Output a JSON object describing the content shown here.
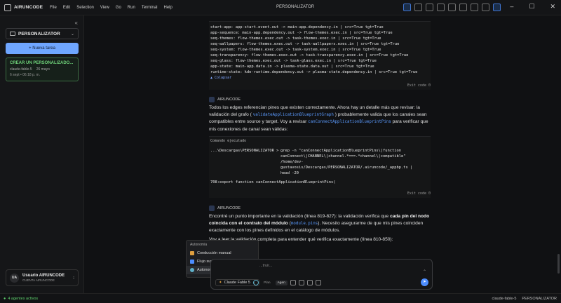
{
  "app": {
    "brand": "AIRUNCODE",
    "window_title": "PERSONALIZATOR",
    "menu": [
      "File",
      "Edit",
      "Selection",
      "View",
      "Go",
      "Run",
      "Terminal",
      "Help"
    ]
  },
  "sidebar": {
    "project": "PERSONALIZATOR",
    "new_task": "+ Nueva tarea",
    "task": {
      "title": "CREAR UN PERSONALIZADO...",
      "branch": "claude-fable-5",
      "age": "26 mayo",
      "date": "6 sept • 06:18 p. m."
    },
    "user": {
      "initials": "UA",
      "name": "Usuario AIRUNCODE",
      "sub": "CUENTA AIRUNCODE"
    }
  },
  "conversation": {
    "output_top": [
      "start-app: app-start.event.out -> main-app.dependency.in | src=True tgt=True",
      "app-sequence: main-app.dependency.out -> flow-themes.exec.in | src=True tgt=True",
      "seq-themes: flow-themes.exec.out -> task-themes.exec.in | src=True tgt=True",
      "seq-wallpapers: flow-themes.exec.out -> task-wallpapers.exec.in | src=True tgt=True",
      "seq-system: flow-themes.exec.out -> task-system.exec.in | src=True tgt=True",
      "seq-transparency: flow-themes.exec.out -> task-transparency.exec.in | src=True tgt=True",
      "seq-glass: flow-themes.exec.out -> task-glass.exec.in | src=True tgt=True",
      "app-state: main-app.data.in -> plasma-state.data.out | src=True tgt=True",
      "runtime-state: kde-runtime.dependency.out -> plasma-state.dependency.in | src=True tgt=True"
    ],
    "collapse": "▲ Colapsar",
    "exit1": "Exit code 0",
    "agent_label": "AIRUNCODE",
    "msg1": {
      "a": "Todos los edges referencian pines que existen correctamente. Ahora hay un detalle más que revisar: la validación del grafo (",
      "code1": "validateApplicationBlueprintGraph",
      "b": ") probablemente valida que los canales sean compatibles entre source y target. Voy a revisar",
      "code2": "canConnectApplicationBlueprintPins",
      "c": "para verificar que mis conexiones de canal sean válidas:"
    },
    "cmd_label": "Comando ejecutado",
    "cmd_prompt": "...\\Descargas\\PERSONALIZATOR >",
    "cmd_lines": [
      "grep -n \"canConnectApplicationBlueprintPins\\|function",
      "canConnect\\|CHANNEL\\|channel.*===.*channel\\|compatible\"",
      "/home/dev-",
      "gustavosis/Descargas/PERSONALIZATOR/.airuncode/_appbp.ts |",
      "head -20"
    ],
    "cmd_output": "708:export function canConnectApplicationBlueprintPins(",
    "exit2": "Exit code 0",
    "msg2": {
      "a": "Encontré un punto importante en la validación (línea 819-827): la validación verifica que ",
      "b_bold": "cada pin del nodo coincida con el contrato del módulo",
      "c": " (",
      "code": "module.pins",
      "d": "). Necesito asegurarme de que mis pines coinciden exactamente con los pines definidos en el catálogo de módulos."
    },
    "msg3": "Voy a leer la validación completa para entender qué verifica exactamente (línea 810-850):"
  },
  "popup": {
    "title": "Autonomía",
    "options": [
      {
        "label": "Conducción manual",
        "color": "#e0a040",
        "selected": false
      },
      {
        "label": "Flujo supervisado",
        "color": "#4c8dff",
        "selected": false
      },
      {
        "label": "Autonomía local",
        "color": "#5fb0c8",
        "selected": true
      }
    ],
    "check": "✓"
  },
  "composer": {
    "placeholder": "...truir...",
    "model": "Claude Fable 5",
    "seg_plan": "Plan",
    "seg_agent": "Agen",
    "send": "➤"
  },
  "statusbar": {
    "agents": "4 agentes activos",
    "branch": "claude-fable-5",
    "project": "PERSONALIZATOR"
  }
}
